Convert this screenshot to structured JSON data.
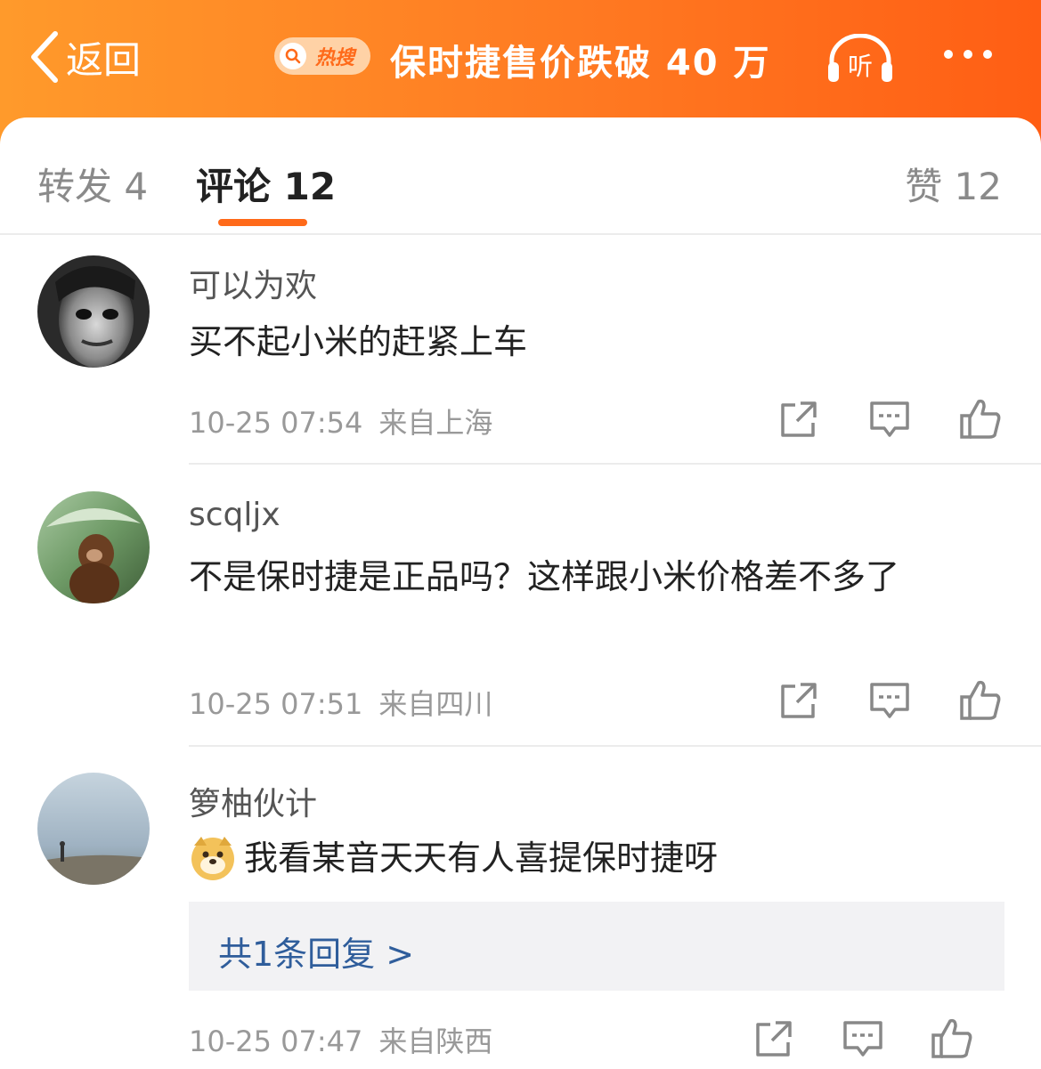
{
  "header": {
    "back_label": "返回",
    "hot_badge_label": "热搜",
    "topic_title": "保时捷售价跌破 40 万",
    "listen_label": "听"
  },
  "tabs": {
    "repost": "转发 4",
    "comment": "评论 12",
    "like": "赞 12"
  },
  "comments": [
    {
      "username": "可以为欢",
      "text": "买不起小米的赶紧上车",
      "time": "10-25 07:54",
      "location": "来自上海"
    },
    {
      "username": "scqljx",
      "text": "不是保时捷是正品吗？这样跟小米价格差不多了",
      "time": "10-25 07:51",
      "location": "来自四川"
    },
    {
      "username": "箩柚伙计",
      "text": "我看某音天天有人喜提保时捷呀",
      "emoji": "doge-emoji",
      "replies_label": "共1条回复 >",
      "time": "10-25 07:47",
      "location": "来自陕西"
    }
  ],
  "colors": {
    "accent": "#ff6a1a",
    "header_gradient_start": "#ff9a2b",
    "header_gradient_end": "#ff5e14",
    "link": "#2f5d9b"
  },
  "icons": [
    "chevron-left-icon",
    "search-icon",
    "headphones-icon",
    "more-dots-icon",
    "share-icon",
    "comment-icon",
    "like-icon"
  ]
}
